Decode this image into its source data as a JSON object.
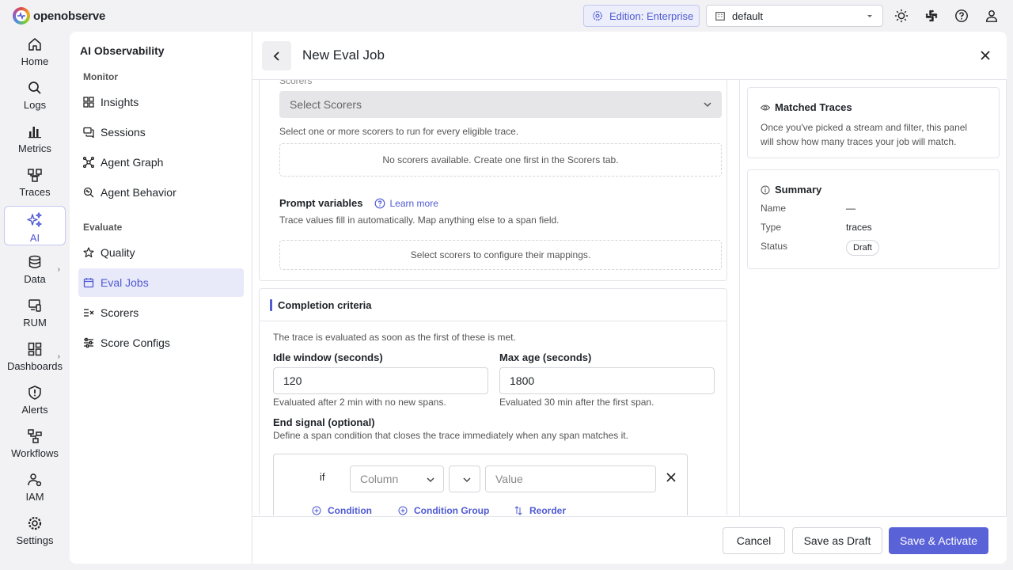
{
  "brand": {
    "name": "openobserve"
  },
  "topbar": {
    "edition": "Edition: Enterprise",
    "org": "default"
  },
  "leftnav": [
    {
      "label": "Home",
      "icon": "home-icon"
    },
    {
      "label": "Logs",
      "icon": "search-icon"
    },
    {
      "label": "Metrics",
      "icon": "bar-chart-icon"
    },
    {
      "label": "Traces",
      "icon": "traces-icon"
    },
    {
      "label": "AI",
      "icon": "sparkles-icon",
      "active": true
    },
    {
      "label": "Data",
      "icon": "database-icon"
    },
    {
      "label": "RUM",
      "icon": "devices-icon"
    },
    {
      "label": "Dashboards",
      "icon": "dashboard-icon"
    },
    {
      "label": "Alerts",
      "icon": "alert-shield-icon"
    },
    {
      "label": "Workflows",
      "icon": "workflow-icon"
    },
    {
      "label": "IAM",
      "icon": "users-icon"
    },
    {
      "label": "Settings",
      "icon": "gear-icon"
    }
  ],
  "sidebar": {
    "title": "AI Observability",
    "groups": {
      "monitor": "Monitor",
      "evaluate": "Evaluate"
    },
    "items": [
      {
        "label": "Insights",
        "icon": "grid-icon"
      },
      {
        "label": "Sessions",
        "icon": "chat-icon"
      },
      {
        "label": "Agent Graph",
        "icon": "graph-icon"
      },
      {
        "label": "Agent Behavior",
        "icon": "behavior-icon"
      },
      {
        "label": "Quality",
        "icon": "star-icon"
      },
      {
        "label": "Eval Jobs",
        "icon": "calendar-icon",
        "active": true
      },
      {
        "label": "Scorers",
        "icon": "scorers-icon"
      },
      {
        "label": "Score Configs",
        "icon": "sliders-icon"
      }
    ]
  },
  "main": {
    "title": "New Eval Job",
    "scorers": {
      "label": "Scorers",
      "placeholder": "Select Scorers",
      "hint": "Select one or more scorers to run for every eligible trace.",
      "empty": "No scorers available. Create one first in the Scorers tab."
    },
    "prompt_vars": {
      "title": "Prompt variables",
      "learn_more": "Learn more",
      "hint": "Trace values fill in automatically. Map anything else to a span field.",
      "empty": "Select scorers to configure their mappings."
    },
    "completion": {
      "title": "Completion criteria",
      "desc": "The trace is evaluated as soon as the first of these is met.",
      "idle_label": "Idle window (seconds)",
      "idle_value": "120",
      "idle_hint": "Evaluated after 2 min with no new spans.",
      "maxage_label": "Max age (seconds)",
      "maxage_value": "1800",
      "maxage_hint": "Evaluated 30 min after the first span.",
      "end_signal_label": "End signal (optional)",
      "end_signal_hint": "Define a span condition that closes the trace immediately when any span matches it.",
      "cond_if": "if",
      "column_placeholder": "Column",
      "value_placeholder": "Value",
      "add_condition": "Condition",
      "add_group": "Condition Group",
      "reorder": "Reorder"
    }
  },
  "side": {
    "matched": {
      "title": "Matched Traces",
      "desc": "Once you've picked a stream and filter, this panel will show how many traces your job will match."
    },
    "summary": {
      "title": "Summary",
      "name_key": "Name",
      "name_val": "—",
      "type_key": "Type",
      "type_val": "traces",
      "status_key": "Status",
      "status_val": "Draft"
    }
  },
  "footer": {
    "cancel": "Cancel",
    "draft": "Save as Draft",
    "activate": "Save & Activate"
  }
}
